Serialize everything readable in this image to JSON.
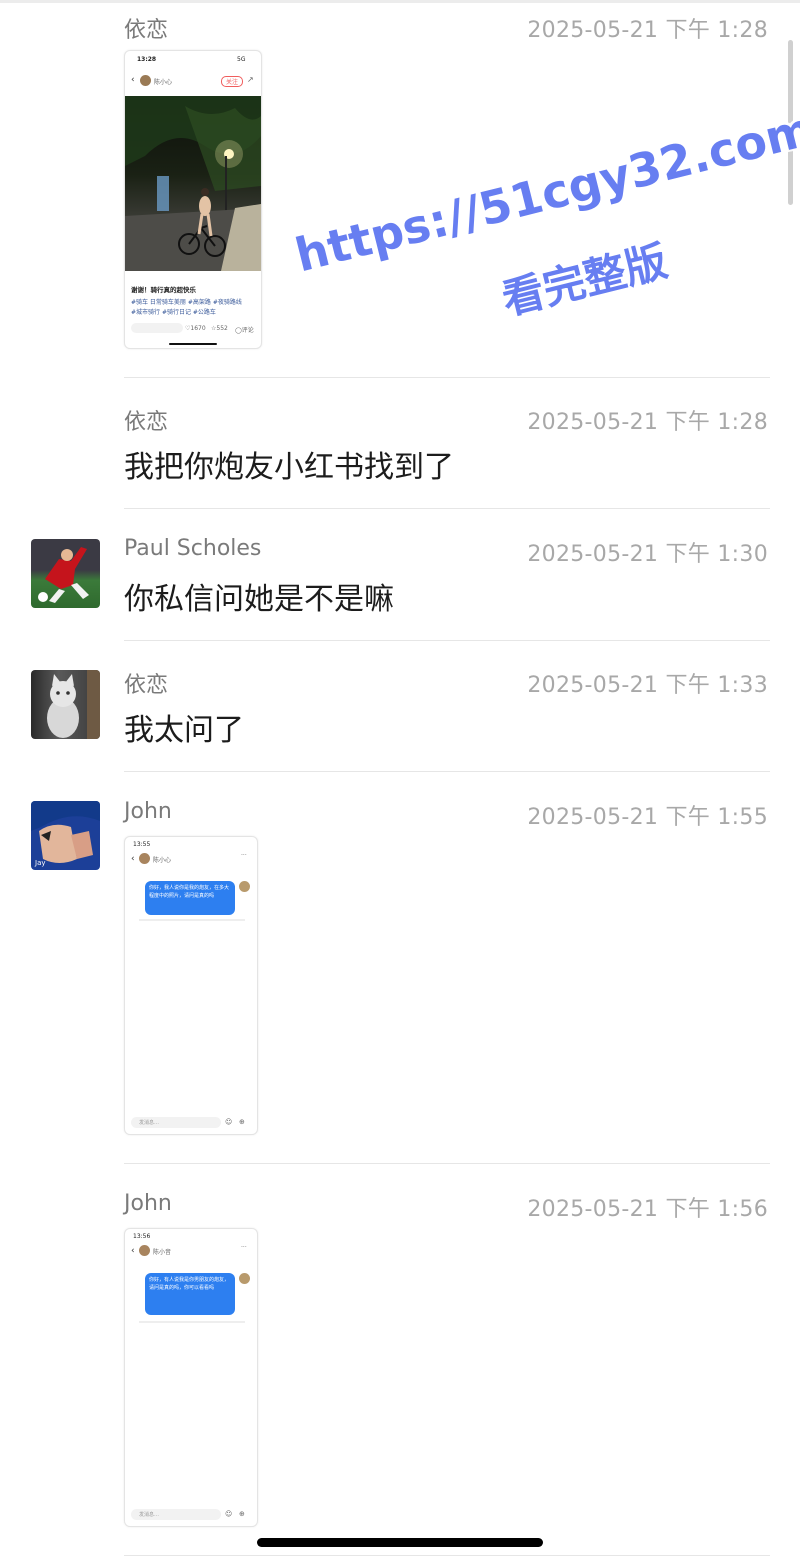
{
  "messages": [
    {
      "name": "依恋",
      "time": "2025-05-21 下午 1:28",
      "type": "image"
    },
    {
      "name": "依恋",
      "time": "2025-05-21 下午 1:28",
      "text": "我把你炮友小红书找到了"
    },
    {
      "name": "Paul Scholes",
      "time": "2025-05-21 下午 1:30",
      "text": "你私信问她是不是嘛"
    },
    {
      "name": "依恋",
      "time": "2025-05-21 下午 1:33",
      "text": "我太问了"
    },
    {
      "name": "John",
      "time": "2025-05-21 下午 1:55",
      "type": "image"
    },
    {
      "name": "John",
      "time": "2025-05-21 下午 1:56",
      "type": "image"
    }
  ],
  "screenshot1": {
    "status_time": "13:28",
    "status_signal": "5G",
    "profile_name": "陈小心",
    "follow_label": "关注",
    "caption": "谢谢！骑行真的超快乐",
    "tags": [
      "#骑车 日常骑车美丽",
      "#高架路",
      "#夜骑路线",
      "#城市骑行",
      "#骑行日记",
      "#公路车"
    ],
    "likes": "1670",
    "stars": "552",
    "comments": "评论"
  },
  "screenshot2": {
    "status_time": "13:55",
    "profile_name": "陈小心",
    "bubble_text": "你好，我人说你是我的炮友，在多大程度中的照片，请问是真的吗",
    "input_placeholder": "发消息…"
  },
  "screenshot3": {
    "status_time": "13:56",
    "profile_name": "陈小音",
    "bubble_text": "你好，有人说我是你男朋友的炮友，请问是真的吗，你可以看看吗",
    "input_placeholder": "发消息…"
  },
  "watermark": {
    "line1": "https://51cgy32.com",
    "line2": "看完整版"
  }
}
